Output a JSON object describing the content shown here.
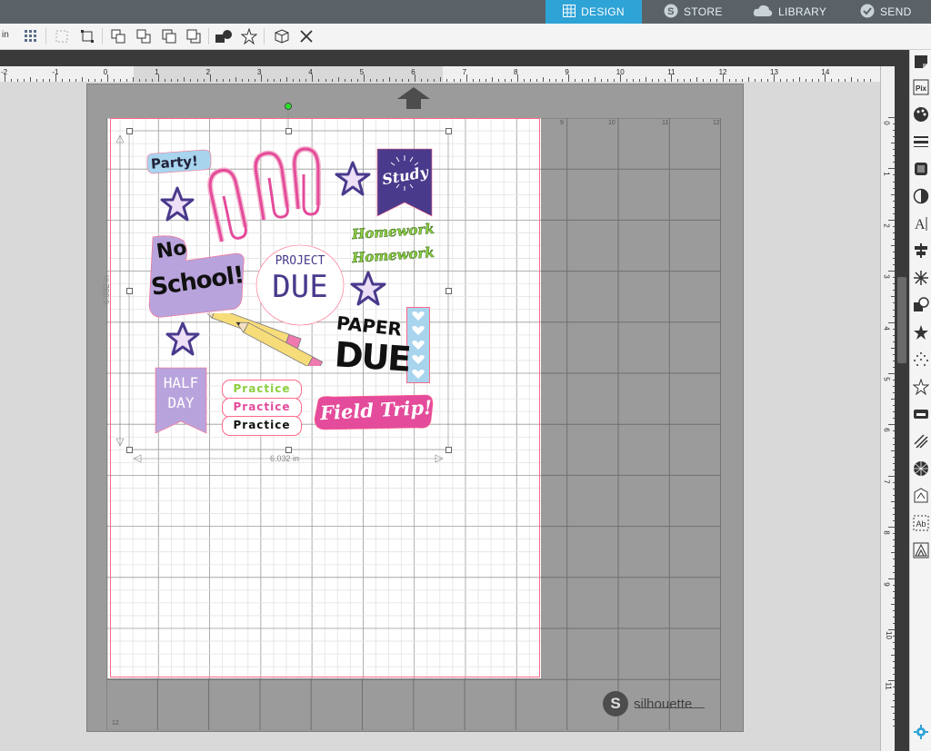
{
  "nav": {
    "design": "DESIGN",
    "store": "STORE",
    "library": "LIBRARY",
    "send": "SEND"
  },
  "toolbar": {
    "units": "in"
  },
  "ruler": {
    "h_labels": [
      "-2",
      "-1",
      "0",
      "1",
      "2",
      "3",
      "4",
      "5",
      "6",
      "7",
      "8",
      "9",
      "10",
      "11",
      "12",
      "13",
      "14"
    ],
    "v_labels": [
      "0",
      "1",
      "2",
      "3",
      "4",
      "5",
      "6",
      "7",
      "8",
      "9",
      "10",
      "11"
    ]
  },
  "mat": {
    "col_labels": [
      "9",
      "10",
      "11",
      "12"
    ],
    "bottom_label": "12",
    "brand": "silhouette",
    "brand_letter": "S"
  },
  "selection": {
    "width_label": "6.032 in",
    "height_label": "6.032 in"
  },
  "stickers": {
    "party": "Party!",
    "study": "Study",
    "homework1": "Homework",
    "homework2": "Homework",
    "no": "No",
    "school": "School!",
    "project": "PROJECT",
    "due": "DUE",
    "paper": "PAPER",
    "paper_due": "DUE",
    "half": "HALF",
    "day": "DAY",
    "practice1": "Practice",
    "practice2": "Practice",
    "practice3": "Practice",
    "field_trip": "Field Trip!"
  },
  "colors": {
    "accent": "#2ea3d6",
    "purple": "#4a3a8c",
    "pink": "#e44b9b",
    "lavender": "#b9a3dc",
    "green": "#8ccf3f",
    "lightblue": "#a8d4ee",
    "cutline": "#ff6a88"
  }
}
